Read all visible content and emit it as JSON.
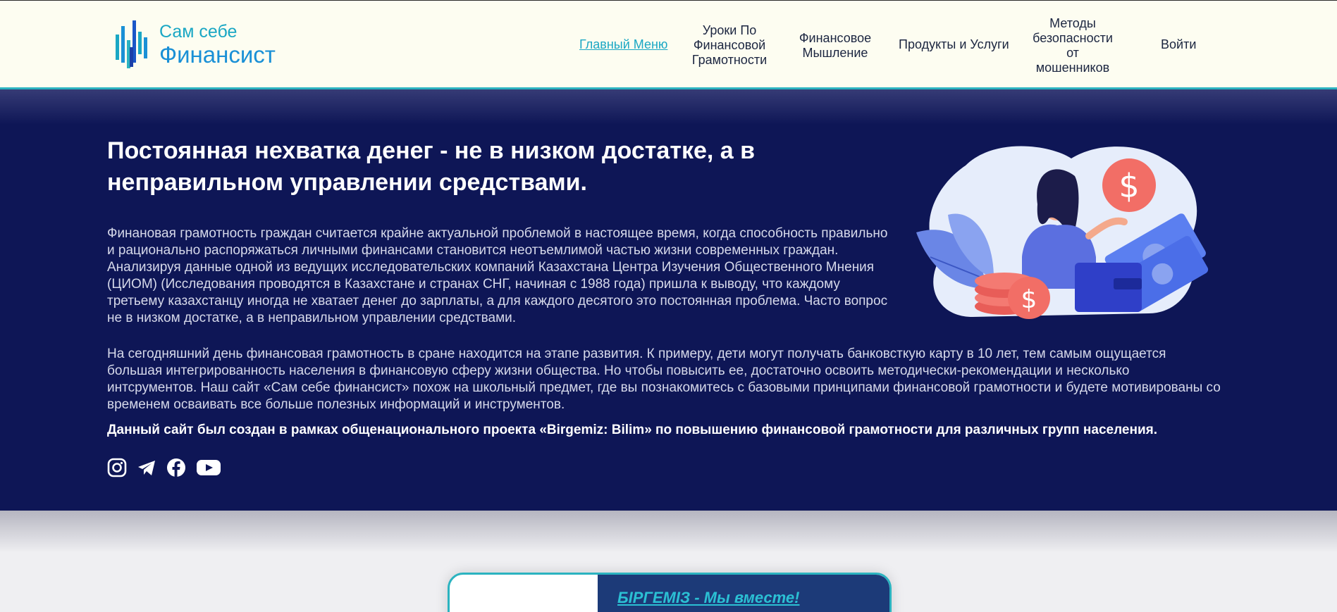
{
  "header": {
    "logo": {
      "line1": "Сам себе",
      "line2": "Финансист"
    },
    "nav": [
      {
        "label": "Главный Меню",
        "active": true
      },
      {
        "label": "Уроки По Финансовой Грамотности"
      },
      {
        "label": "Финансовое Мышление"
      },
      {
        "label": "Продукты и Услуги"
      },
      {
        "label": "Методы безопасности от мошенников"
      },
      {
        "label": "Войти"
      }
    ]
  },
  "hero": {
    "title": "Постоянная нехватка денег - не в низком достатке, а в неправильном управлении средствами.",
    "paragraph1": "Финановая грамотность граждан считается крайне актуальной проблемой в настоящее время, когда способность правильно и рационально распоряжаться личными финансами становится неотъемлимой частью жизни современных граждан. Анализируя данные одной из ведущих исследовательских компаний Казахстана Центра Изучения Общественного Мнения (ЦИОМ) (Исследования проводятся в Казахстане и странах СНГ, начиная с 1988 года) пришла к выводу, что каждому третьему казахстанцу иногда не хватает денег до зарплаты, а для каждого десятого это постоянная проблема. Часто вопрос не в низком достатке, а в неправильном управлении средствами.",
    "paragraph2": "На сегодняшний день финансовая грамотность в сране находится на этапе развития. К примеру, дети могут получать банковсткую карту в 10 лет, тем самым ощущается большая интегрированность населения в финансовую сферу жизни общества. Но чтобы повысить ее, достаточно освоить методически-рекомендации и несколько интсрументов. Наш сайт «Сам себе финансист» похож на школьный предмет, где вы познакомитесь с базовыми принципами финансовой грамотности и будете мотивированы со временем осваивать все больше полезных информаций и инструментов.",
    "paragraph3": "Данный сайт был создан в рамках общенационального проекта «Birgemiz: Bilim» по повышению финансовой грамотности для различных групп населения.",
    "socials": [
      "instagram-icon",
      "telegram-icon",
      "facebook-icon",
      "youtube-icon"
    ]
  },
  "card": {
    "link": "БІРГЕМІЗ - Мы вместе!"
  },
  "colors": {
    "navy": "#0e1656",
    "accent": "#1aa7c4",
    "header_bg": "#fdfdf1"
  }
}
